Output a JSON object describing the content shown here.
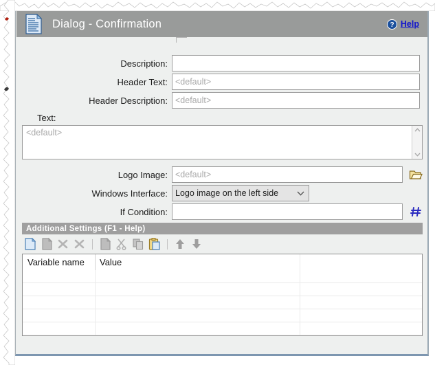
{
  "window": {
    "title": "Dialog - Confirmation",
    "title_icon": "document-icon",
    "help_label": "Help",
    "help_icon": "question-circle-icon"
  },
  "form": {
    "fields": [
      {
        "label": "Description:",
        "value": "",
        "placeholder": ""
      },
      {
        "label": "Header Text:",
        "value": "<default>",
        "placeholder": "<default>"
      },
      {
        "label": "Header Description:",
        "value": "<default>",
        "placeholder": "<default>"
      }
    ],
    "text_block": {
      "label": "Text:",
      "value": "<default>",
      "scroll_up_icon": "chevron-up-icon",
      "scroll_down_icon": "chevron-down-icon"
    },
    "logo_image": {
      "label": "Logo Image:",
      "value": "<default>",
      "browse_icon": "open-folder-icon"
    },
    "windows_interface": {
      "label": "Windows Interface:",
      "selected": "Logo image on the left side",
      "dropdown_icon": "chevron-down-icon"
    },
    "if_condition": {
      "label": "If Condition:",
      "value": "",
      "hash_icon": "hash-icon"
    }
  },
  "additional_settings": {
    "header": "Additional Settings (F1 - Help)",
    "toolbar": [
      {
        "name": "new-record-icon",
        "enabled": true
      },
      {
        "name": "duplicate-record-icon",
        "enabled": false
      },
      {
        "name": "delete-record-icon",
        "enabled": false
      },
      {
        "name": "delete-all-records-icon",
        "enabled": false
      },
      {
        "name": "separator",
        "enabled": false
      },
      {
        "name": "copy-page-icon",
        "enabled": false
      },
      {
        "name": "cut-icon",
        "enabled": false
      },
      {
        "name": "copy-icon",
        "enabled": false
      },
      {
        "name": "paste-icon",
        "enabled": true
      },
      {
        "name": "separator",
        "enabled": false
      },
      {
        "name": "move-up-icon",
        "enabled": false
      },
      {
        "name": "move-down-icon",
        "enabled": false
      }
    ],
    "table": {
      "columns": [
        "Variable name",
        "Value",
        ""
      ],
      "rows": [
        [
          "",
          "",
          ""
        ],
        [
          "",
          "",
          ""
        ],
        [
          "",
          "",
          ""
        ],
        [
          "",
          "",
          ""
        ],
        [
          "",
          "",
          ""
        ]
      ]
    }
  },
  "colors": {
    "titlebar": "#999b9a",
    "section_header": "#9f9f9f",
    "body": "#eef0ef",
    "link": "#1316cd",
    "placeholder": "#a8a8a8",
    "accent_bottom": "#7d96b0"
  }
}
